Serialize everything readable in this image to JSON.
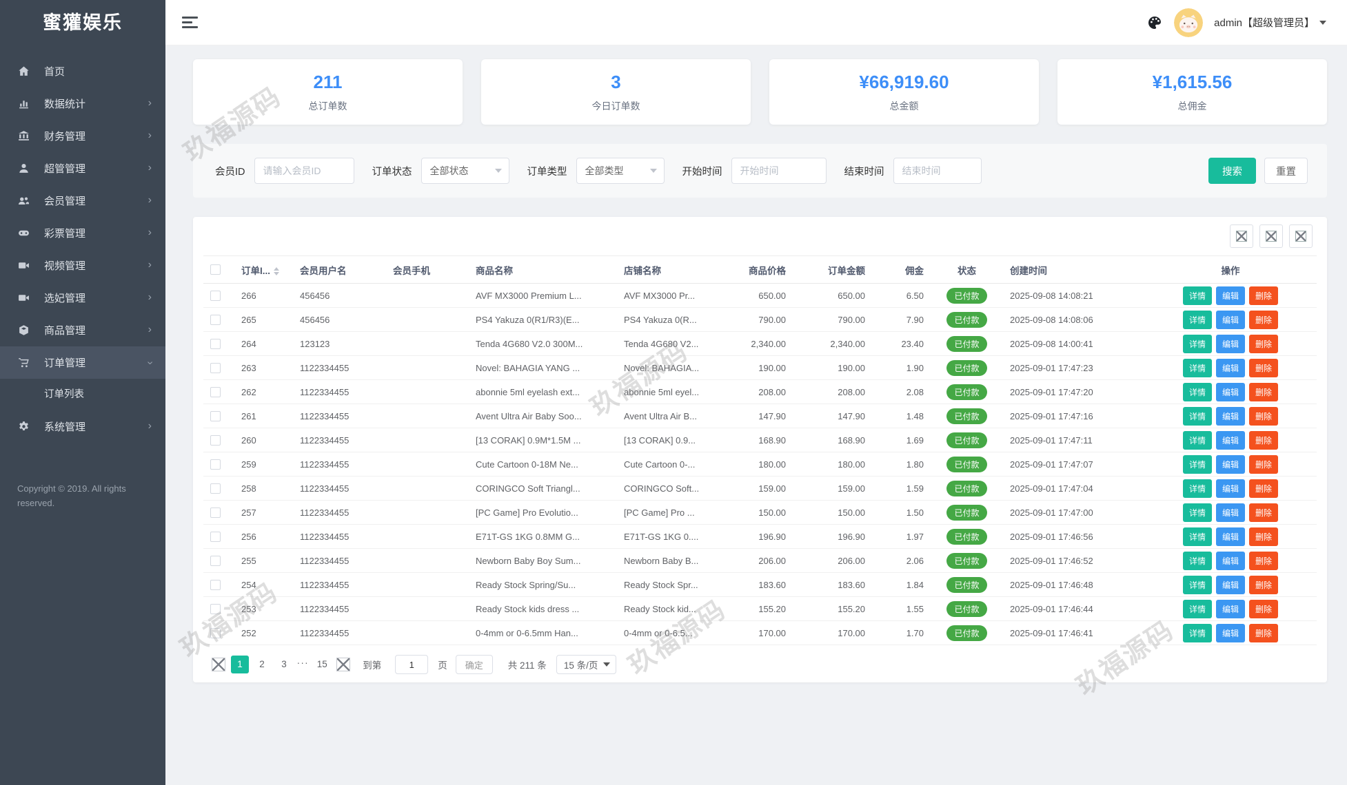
{
  "brand": "蜜獾娱乐",
  "topbar": {
    "admin": "admin【超级管理员】"
  },
  "sidebar": {
    "items": [
      {
        "key": "home",
        "label": "首页",
        "icon": "home-icon",
        "expandable": false
      },
      {
        "key": "stats",
        "label": "数据统计",
        "icon": "chart-icon",
        "expandable": true
      },
      {
        "key": "finance",
        "label": "财务管理",
        "icon": "bank-icon",
        "expandable": true
      },
      {
        "key": "superadmin",
        "label": "超管管理",
        "icon": "user-icon",
        "expandable": true
      },
      {
        "key": "members",
        "label": "会员管理",
        "icon": "users-icon",
        "expandable": true
      },
      {
        "key": "lottery",
        "label": "彩票管理",
        "icon": "gamepad-icon",
        "expandable": true
      },
      {
        "key": "video",
        "label": "视频管理",
        "icon": "video-icon",
        "expandable": true
      },
      {
        "key": "concubine",
        "label": "选妃管理",
        "icon": "video-icon",
        "expandable": true
      },
      {
        "key": "products",
        "label": "商品管理",
        "icon": "box-icon",
        "expandable": true
      },
      {
        "key": "orders",
        "label": "订单管理",
        "icon": "cart-icon",
        "expandable": true,
        "active": true,
        "expanded": true,
        "children": [
          {
            "key": "order-list",
            "label": "订单列表"
          }
        ]
      },
      {
        "key": "system",
        "label": "系统管理",
        "icon": "gear-icon",
        "expandable": true
      }
    ],
    "copyright": "Copyright © 2019. All rights reserved."
  },
  "stats": [
    {
      "value": "211",
      "label": "总订单数"
    },
    {
      "value": "3",
      "label": "今日订单数"
    },
    {
      "value": "¥66,919.60",
      "label": "总金额"
    },
    {
      "value": "¥1,615.56",
      "label": "总佣金"
    }
  ],
  "filters": {
    "member_id_label": "会员ID",
    "member_id_placeholder": "请输入会员ID",
    "order_status_label": "订单状态",
    "order_status_value": "全部状态",
    "order_type_label": "订单类型",
    "order_type_value": "全部类型",
    "start_time_label": "开始时间",
    "start_time_placeholder": "开始时间",
    "end_time_label": "结束时间",
    "end_time_placeholder": "结束时间",
    "search_label": "搜索",
    "reset_label": "重置"
  },
  "table": {
    "toolbar_icons": [
      "broken-image-icon",
      "broken-image-icon",
      "broken-image-icon"
    ],
    "columns": [
      "订单I...",
      "会员用户名",
      "会员手机",
      "商品名称",
      "店铺名称",
      "商品价格",
      "订单金额",
      "佣金",
      "状态",
      "创建时间",
      "操作"
    ],
    "action_labels": {
      "detail": "详情",
      "edit": "编辑",
      "del": "删除"
    },
    "rows": [
      {
        "id": "266",
        "user": "456456",
        "phone": "",
        "product": "AVF MX3000 Premium L...",
        "store": "AVF MX3000 Pr...",
        "price": "650.00",
        "amount": "650.00",
        "commission": "6.50",
        "status": "已付款",
        "created": "2025-09-08 14:08:21"
      },
      {
        "id": "265",
        "user": "456456",
        "phone": "",
        "product": "PS4 Yakuza 0(R1/R3)(E...",
        "store": "PS4 Yakuza 0(R...",
        "price": "790.00",
        "amount": "790.00",
        "commission": "7.90",
        "status": "已付款",
        "created": "2025-09-08 14:08:06"
      },
      {
        "id": "264",
        "user": "123123",
        "phone": "",
        "product": "Tenda 4G680 V2.0 300M...",
        "store": "Tenda 4G680 V2...",
        "price": "2,340.00",
        "amount": "2,340.00",
        "commission": "23.40",
        "status": "已付款",
        "created": "2025-09-08 14:00:41"
      },
      {
        "id": "263",
        "user": "1122334455",
        "phone": "",
        "product": "Novel: BAHAGIA YANG ...",
        "store": "Novel: BAHAGIA...",
        "price": "190.00",
        "amount": "190.00",
        "commission": "1.90",
        "status": "已付款",
        "created": "2025-09-01 17:47:23"
      },
      {
        "id": "262",
        "user": "1122334455",
        "phone": "",
        "product": "abonnie 5ml eyelash ext...",
        "store": "abonnie 5ml eyel...",
        "price": "208.00",
        "amount": "208.00",
        "commission": "2.08",
        "status": "已付款",
        "created": "2025-09-01 17:47:20"
      },
      {
        "id": "261",
        "user": "1122334455",
        "phone": "",
        "product": "Avent Ultra Air Baby Soo...",
        "store": "Avent Ultra Air B...",
        "price": "147.90",
        "amount": "147.90",
        "commission": "1.48",
        "status": "已付款",
        "created": "2025-09-01 17:47:16"
      },
      {
        "id": "260",
        "user": "1122334455",
        "phone": "",
        "product": "[13 CORAK] 0.9M*1.5M ...",
        "store": "[13 CORAK] 0.9...",
        "price": "168.90",
        "amount": "168.90",
        "commission": "1.69",
        "status": "已付款",
        "created": "2025-09-01 17:47:11"
      },
      {
        "id": "259",
        "user": "1122334455",
        "phone": "",
        "product": "Cute Cartoon 0-18M Ne...",
        "store": "Cute Cartoon 0-...",
        "price": "180.00",
        "amount": "180.00",
        "commission": "1.80",
        "status": "已付款",
        "created": "2025-09-01 17:47:07"
      },
      {
        "id": "258",
        "user": "1122334455",
        "phone": "",
        "product": "CORINGCO Soft Triangl...",
        "store": "CORINGCO Soft...",
        "price": "159.00",
        "amount": "159.00",
        "commission": "1.59",
        "status": "已付款",
        "created": "2025-09-01 17:47:04"
      },
      {
        "id": "257",
        "user": "1122334455",
        "phone": "",
        "product": "[PC Game] Pro Evolutio...",
        "store": "[PC Game] Pro ...",
        "price": "150.00",
        "amount": "150.00",
        "commission": "1.50",
        "status": "已付款",
        "created": "2025-09-01 17:47:00"
      },
      {
        "id": "256",
        "user": "1122334455",
        "phone": "",
        "product": "E71T-GS 1KG 0.8MM G...",
        "store": "E71T-GS 1KG 0....",
        "price": "196.90",
        "amount": "196.90",
        "commission": "1.97",
        "status": "已付款",
        "created": "2025-09-01 17:46:56"
      },
      {
        "id": "255",
        "user": "1122334455",
        "phone": "",
        "product": "Newborn Baby Boy Sum...",
        "store": "Newborn Baby B...",
        "price": "206.00",
        "amount": "206.00",
        "commission": "2.06",
        "status": "已付款",
        "created": "2025-09-01 17:46:52"
      },
      {
        "id": "254",
        "user": "1122334455",
        "phone": "",
        "product": "Ready Stock Spring/Su...",
        "store": "Ready Stock Spr...",
        "price": "183.60",
        "amount": "183.60",
        "commission": "1.84",
        "status": "已付款",
        "created": "2025-09-01 17:46:48"
      },
      {
        "id": "253",
        "user": "1122334455",
        "phone": "",
        "product": "Ready Stock kids dress ...",
        "store": "Ready Stock kid...",
        "price": "155.20",
        "amount": "155.20",
        "commission": "1.55",
        "status": "已付款",
        "created": "2025-09-01 17:46:44"
      },
      {
        "id": "252",
        "user": "1122334455",
        "phone": "",
        "product": "0-4mm or 0-6.5mm Han...",
        "store": "0-4mm or 0-6.5...",
        "price": "170.00",
        "amount": "170.00",
        "commission": "1.70",
        "status": "已付款",
        "created": "2025-09-01 17:46:41"
      }
    ]
  },
  "pagination": {
    "prev_icon": "broken-image-icon",
    "next_icon": "broken-image-icon",
    "pages": [
      "1",
      "2",
      "3",
      "...",
      "15"
    ],
    "active_page": "1",
    "goto_label": "到第",
    "goto_value": "1",
    "page_word": "页",
    "confirm_label": "确定",
    "total_label": "共 211 条",
    "per_page": "15 条/页"
  },
  "watermark": {
    "text": "玖福源码"
  },
  "colors": {
    "sidebar_bg": "#3d4753",
    "accent_blue": "#3d8ef8",
    "teal": "#18bc9c",
    "edit_blue": "#3b97f2",
    "delete_red": "#f4511e",
    "paid_green": "#45a845"
  }
}
